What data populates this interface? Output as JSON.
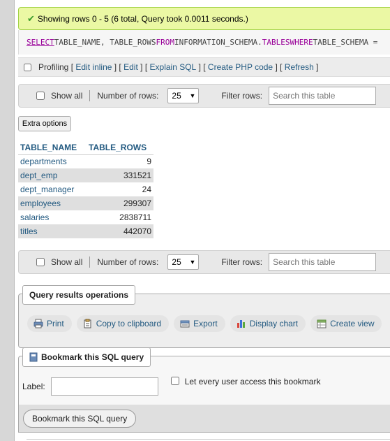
{
  "message": {
    "text": "Showing rows 0 - 5 (6 total, Query took 0.0011 seconds.)",
    "icon": "check-icon",
    "bg_color": "#ebf8a4"
  },
  "sql": {
    "select": "SELECT",
    "part1": " TABLE_NAME, TABLE_ROWS ",
    "from": "FROM",
    "part2": " INFORMATION_SCHEMA.",
    "tables": "TABLES",
    "space": " ",
    "where": "WHERE",
    "part3": " TABLE_SCHEMA ="
  },
  "profiling": {
    "label": "Profiling",
    "lb1": "[",
    "edit_inline": "Edit inline",
    "sep1": "] [",
    "edit": "Edit",
    "sep2": "] [",
    "explain": "Explain SQL",
    "sep3": "] [",
    "php": "Create PHP code",
    "sep4": "] [",
    "refresh": "Refresh",
    "rb": "]"
  },
  "nav": {
    "show_all": "Show all",
    "rows_label": "Number of rows:",
    "rows_value": "25",
    "filter_label": "Filter rows:",
    "search_placeholder": "Search this table"
  },
  "extra_options": "Extra options",
  "table": {
    "headers": [
      "TABLE_NAME",
      "TABLE_ROWS"
    ],
    "rows": [
      {
        "name": "departments",
        "rows": "9"
      },
      {
        "name": "dept_emp",
        "rows": "331521"
      },
      {
        "name": "dept_manager",
        "rows": "24"
      },
      {
        "name": "employees",
        "rows": "299307"
      },
      {
        "name": "salaries",
        "rows": "2838711"
      },
      {
        "name": "titles",
        "rows": "442070"
      }
    ]
  },
  "operations": {
    "legend": "Query results operations",
    "buttons": [
      {
        "label": "Print",
        "icon": "printer-icon"
      },
      {
        "label": "Copy to clipboard",
        "icon": "clipboard-icon"
      },
      {
        "label": "Export",
        "icon": "export-icon"
      },
      {
        "label": "Display chart",
        "icon": "chart-icon"
      },
      {
        "label": "Create view",
        "icon": "view-icon"
      }
    ]
  },
  "bookmark": {
    "legend": "Bookmark this SQL query",
    "label": "Label:",
    "share_label": "Let every user access this bookmark",
    "submit": "Bookmark this SQL query"
  }
}
